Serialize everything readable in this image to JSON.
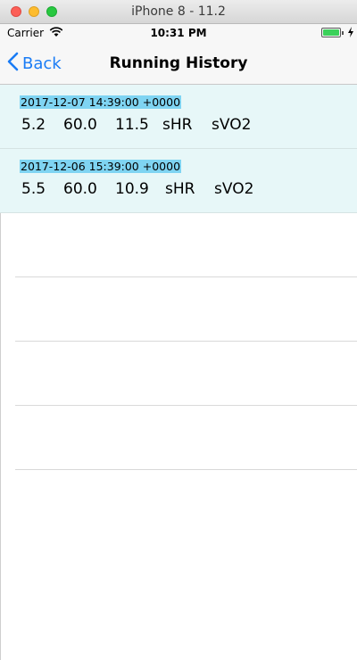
{
  "window": {
    "title": "iPhone 8 - 11.2"
  },
  "status": {
    "carrier": "Carrier",
    "time": "10:31 PM"
  },
  "nav": {
    "back_label": "Back",
    "title": "Running History"
  },
  "rows": [
    {
      "date": "2017-12-07 14:39:00 +0000",
      "v1": "5.2",
      "v2": "60.0",
      "v3": "11.5",
      "v4": "sHR",
      "v5": "sVO2"
    },
    {
      "date": "2017-12-06 15:39:00 +0000",
      "v1": "5.5",
      "v2": "60.0",
      "v3": "10.9",
      "v4": "sHR",
      "v5": "sVO2"
    }
  ],
  "colors": {
    "accent": "#1a7cf5",
    "highlight": "#7fd4f2",
    "row_bg": "#e7f7f8",
    "battery": "#3bd15a"
  }
}
